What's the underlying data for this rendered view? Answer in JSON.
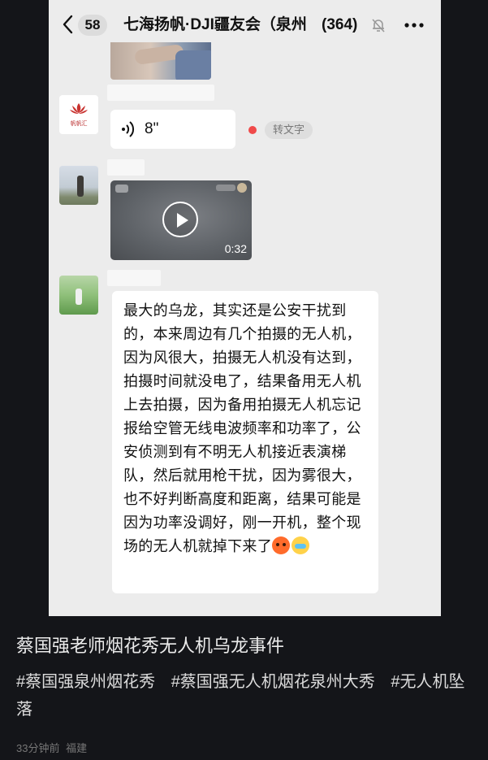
{
  "chat": {
    "unread_count": "58",
    "title": "七海扬帆·DJI疆友会（泉州",
    "member_count": "(364)",
    "messages": {
      "voice_duration": "8\"",
      "transcribe_label": "转文字",
      "video_duration": "0:32",
      "text": "最大的乌龙，其实还是公安干扰到的，本来周边有几个拍摄的无人机，因为风很大，拍摄无人机没有达到，拍摄时间就没电了，结果备用无人机上去拍摄，因为备用拍摄无人机忘记报给空管无线电波频率和功率了，公安侦测到有不明无人机接近表演梯队，然后就用枪干扰，因为雾很大，也不好判断高度和距离，结果可能是因为功率没调好，刚一开机，整个现场的无人机就掉下来了"
    },
    "avatar_1_text": "帆帆汇"
  },
  "post": {
    "title": "蔡国强老师烟花秀无人机乌龙事件",
    "hashtags": [
      "#蔡国强泉州烟花秀",
      "#蔡国强无人机烟花泉州大秀",
      "#无人机坠落"
    ],
    "time": "33分钟前",
    "location": "福建"
  },
  "icons": [
    "back-arrow-icon",
    "mute-bell-icon",
    "more-icon",
    "voice-icon",
    "play-icon",
    "angry-emoji",
    "crying-emoji"
  ]
}
